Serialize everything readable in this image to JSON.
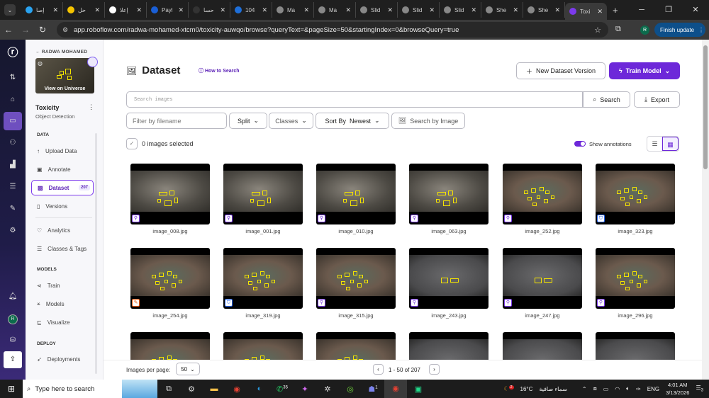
{
  "browser": {
    "tabs": [
      {
        "label": "إصا",
        "color": "#2aa3f0"
      },
      {
        "label": "حل",
        "color": "#f5c400"
      },
      {
        "label": "إعلا",
        "color": "#ffffff"
      },
      {
        "label": "Payl",
        "color": "#1a5fd6"
      },
      {
        "label": "حسا",
        "color": "#333333"
      },
      {
        "label": "104",
        "color": "#1e6fd9"
      },
      {
        "label": "Ma",
        "color": "#888888"
      },
      {
        "label": "Ma",
        "color": "#888888"
      },
      {
        "label": "Slid",
        "color": "#888888"
      },
      {
        "label": "Slid",
        "color": "#888888"
      },
      {
        "label": "Slid",
        "color": "#888888"
      },
      {
        "label": "She",
        "color": "#888888"
      },
      {
        "label": "She",
        "color": "#888888"
      },
      {
        "label": "Toxi",
        "color": "#7c3aed",
        "active": true
      }
    ],
    "url": "app.roboflow.com/radwa-mohamed-xtcm0/toxicity-auwqo/browse?queryText=&pageSize=50&startingIndex=0&browseQuery=true",
    "profile_initial": "R",
    "finish_update": "Finish update"
  },
  "rail": {
    "avatar": "R"
  },
  "sidebar": {
    "workspace": "RADWA MOHAMED",
    "view_universe": "View on Universe",
    "project": "Toxicity",
    "project_type": "Object Detection",
    "sections": {
      "data": "DATA",
      "models": "MODELS",
      "deploy": "DEPLOY"
    },
    "items": [
      {
        "label": "Upload Data",
        "icon": "↑"
      },
      {
        "label": "Annotate",
        "icon": "▣"
      },
      {
        "label": "Dataset",
        "icon": "▨",
        "badge": "207",
        "active": true
      },
      {
        "label": "Versions",
        "icon": "▯"
      },
      {
        "label": "Analytics",
        "icon": "♡"
      },
      {
        "label": "Classes & Tags",
        "icon": "☰"
      },
      {
        "label": "Train",
        "icon": "⋖"
      },
      {
        "label": "Models",
        "icon": "⚹"
      },
      {
        "label": "Visualize",
        "icon": "⊑"
      },
      {
        "label": "Deployments",
        "icon": "➶"
      }
    ]
  },
  "header": {
    "title": "Dataset",
    "how_to_search": "How to Search",
    "new_version": "New Dataset Version",
    "train_model": "Train Model"
  },
  "search": {
    "placeholder": "Search images",
    "search_label": "Search",
    "export_label": "Export",
    "filter_placeholder": "Filter by filename",
    "split": "Split",
    "classes": "Classes",
    "sort_by": "Sort By",
    "sort_value": "Newest",
    "search_by_image": "Search by Image"
  },
  "selection": {
    "selected_text": "0 images selected",
    "show_annotations": "Show annotations",
    "show_annotations_on": true
  },
  "images": [
    {
      "name": "image_008.jpg",
      "split": "train",
      "scene": "cloth"
    },
    {
      "name": "image_001.jpg",
      "split": "train",
      "scene": "cloth"
    },
    {
      "name": "image_010.jpg",
      "split": "train",
      "scene": "cloth"
    },
    {
      "name": "image_063.jpg",
      "split": "train",
      "scene": "cloth"
    },
    {
      "name": "image_252.jpg",
      "split": "train",
      "scene": "tiles"
    },
    {
      "name": "image_323.jpg",
      "split": "valid",
      "scene": "tiles"
    },
    {
      "name": "image_254.jpg",
      "split": "test",
      "scene": "tiles"
    },
    {
      "name": "image_319.jpg",
      "split": "valid",
      "scene": "tiles"
    },
    {
      "name": "image_315.jpg",
      "split": "train",
      "scene": "tiles"
    },
    {
      "name": "image_243.jpg",
      "split": "train",
      "scene": "sheet"
    },
    {
      "name": "image_247.jpg",
      "split": "train",
      "scene": "sheet"
    },
    {
      "name": "image_296.jpg",
      "split": "train",
      "scene": "tiles"
    }
  ],
  "pagination": {
    "per_page_label": "Images per page:",
    "per_page": "50",
    "range": "1 - 50 of 207"
  },
  "taskbar": {
    "search_placeholder": "Type here to search",
    "whatsapp_badge": "35",
    "teams_badge": "1",
    "weather_badge": "2",
    "temperature": "16°C",
    "weather": "سماء صافية",
    "lang": "ENG",
    "time": "4:01 AM",
    "date": "3/13/2026",
    "notifications": "3"
  }
}
